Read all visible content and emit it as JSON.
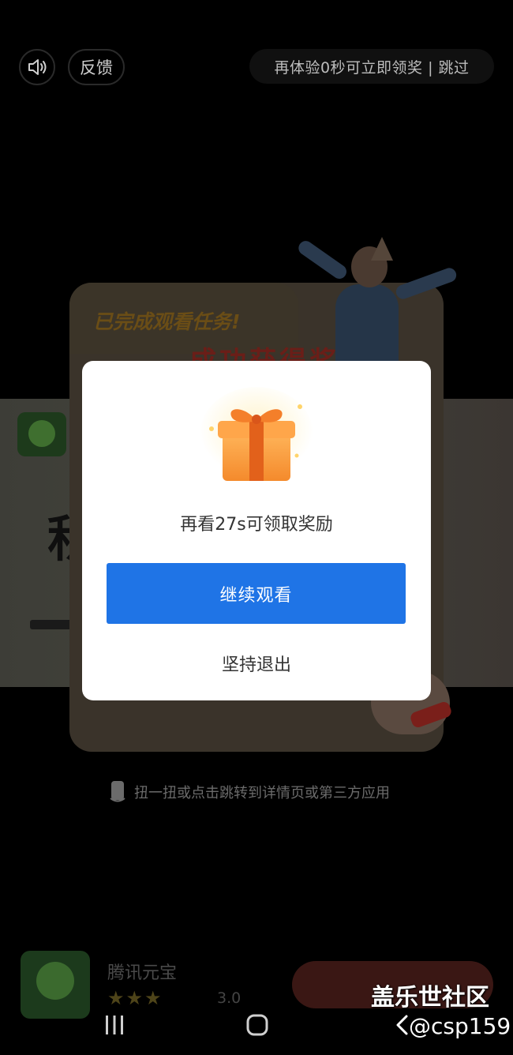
{
  "top_bar": {
    "feedback_label": "反馈",
    "skip_text": "再体验0秒可立即领奖 | 跳过"
  },
  "background": {
    "reward_task_text": "已完成观看任务!",
    "reward_success_text": "成功获得奖励"
  },
  "dialog": {
    "message": "再看27s可领取奖励",
    "continue_label": "继续观看",
    "exit_label": "坚持退出"
  },
  "hint": {
    "text": "扭一扭或点击跳转到详情页或第三方应用"
  },
  "ad": {
    "app_name": "腾讯元宝",
    "stars": "★★★",
    "rating": "3.0"
  },
  "watermark": {
    "title": "盖乐世社区",
    "handle": "@csp159"
  },
  "colors": {
    "primary_button": "#1f74e6",
    "dialog_bg": "#ffffff",
    "backdrop": "#000000"
  },
  "icons": {
    "sound": "speaker-icon",
    "gift": "gift-box-icon",
    "phone": "phone-icon",
    "recents": "recents-icon",
    "home": "home-icon",
    "back": "back-icon"
  }
}
